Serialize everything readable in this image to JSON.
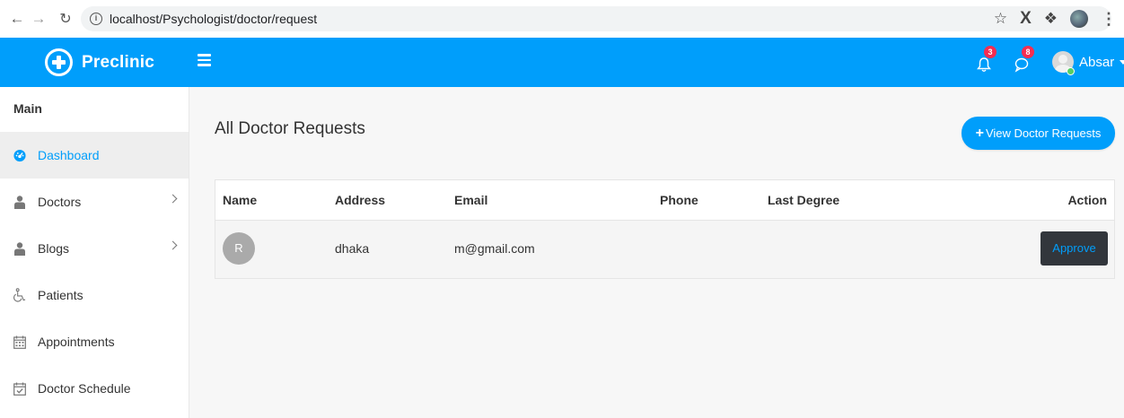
{
  "browser": {
    "url": "localhost/Psychologist/doctor/request",
    "back_icon": "arrow-left-icon",
    "forward_icon": "arrow-right-icon",
    "reload_icon": "reload-icon"
  },
  "header": {
    "brand_name": "Preclinic",
    "notifications_count": "3",
    "messages_count": "8",
    "user_name": "Absar",
    "accent_color": "#009efb"
  },
  "sidebar": {
    "section_title": "Main",
    "items": [
      {
        "label": "Dashboard",
        "icon": "dashboard-icon",
        "active": true
      },
      {
        "label": "Doctors",
        "icon": "user-md-icon",
        "has_submenu": true
      },
      {
        "label": "Blogs",
        "icon": "user-icon",
        "has_submenu": true
      },
      {
        "label": "Patients",
        "icon": "wheelchair-icon"
      },
      {
        "label": "Appointments",
        "icon": "calendar-icon"
      },
      {
        "label": "Doctor Schedule",
        "icon": "calendar-check-icon"
      }
    ]
  },
  "main": {
    "page_title": "All Doctor Requests",
    "add_button_label": "View Doctor Requests",
    "table": {
      "headers": [
        "Name",
        "Address",
        "Email",
        "Phone",
        "Last Degree",
        "Action"
      ],
      "rows": [
        {
          "avatar_initial": "R",
          "name": "",
          "address": "dhaka",
          "email": "m@gmail.com",
          "phone": "",
          "last_degree": "",
          "action_label": "Approve"
        }
      ]
    }
  }
}
